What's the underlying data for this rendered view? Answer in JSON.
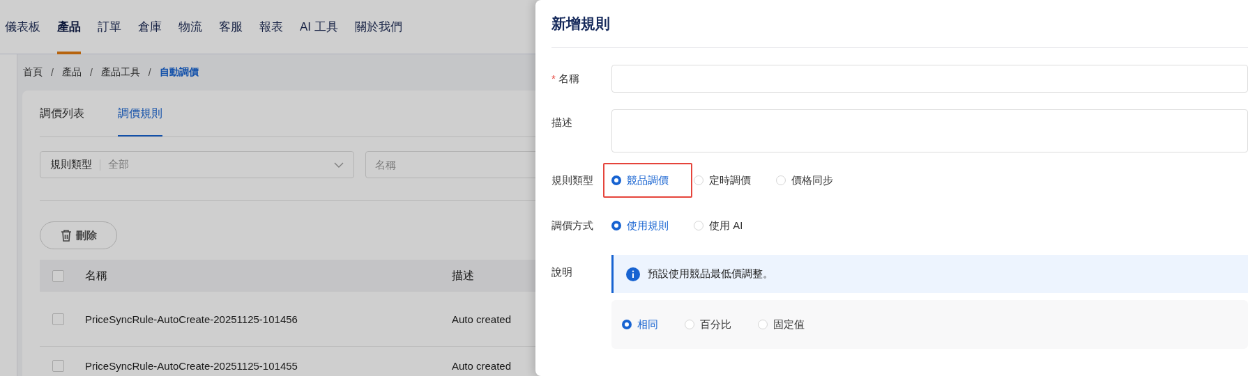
{
  "nav": [
    {
      "label": "儀表板",
      "selected": false
    },
    {
      "label": "產品",
      "selected": true
    },
    {
      "label": "訂單",
      "selected": false
    },
    {
      "label": "倉庫",
      "selected": false
    },
    {
      "label": "物流",
      "selected": false
    },
    {
      "label": "客服",
      "selected": false
    },
    {
      "label": "報表",
      "selected": false
    },
    {
      "label": "AI 工具",
      "selected": false
    },
    {
      "label": "關於我們",
      "selected": false
    }
  ],
  "breadcrumb": {
    "separator": "/",
    "items": [
      {
        "label": "首頁",
        "current": false
      },
      {
        "label": "產品",
        "current": false
      },
      {
        "label": "產品工具",
        "current": false
      },
      {
        "label": "自動調價",
        "current": true
      }
    ]
  },
  "tabs": [
    {
      "label": "調價列表",
      "selected": false
    },
    {
      "label": "調價規則",
      "selected": true
    }
  ],
  "filters": {
    "rule_type": {
      "label": "規則類型",
      "value": "全部"
    },
    "name": {
      "placeholder": "名稱"
    }
  },
  "delete_button": "刪除",
  "table": {
    "columns": [
      "名稱",
      "描述"
    ],
    "header_checked": false,
    "rows": [
      {
        "checked": false,
        "name": "PriceSyncRule-AutoCreate-20251125-101456",
        "description": "Auto created"
      },
      {
        "checked": false,
        "name": "PriceSyncRule-AutoCreate-20251125-101455",
        "description": "Auto created"
      }
    ]
  },
  "drawer": {
    "title": "新增規則",
    "required_mark": "*",
    "fields": [
      {
        "kind": "input",
        "label": "名稱",
        "required": true
      },
      {
        "kind": "textarea",
        "label": "描述",
        "required": false
      },
      {
        "kind": "radio",
        "label": "規則類型",
        "options": [
          {
            "label": "競品調價",
            "selected": true,
            "highlighted": true
          },
          {
            "label": "定時調價",
            "selected": false,
            "highlighted": false
          },
          {
            "label": "價格同步",
            "selected": false,
            "highlighted": false
          }
        ]
      },
      {
        "kind": "radio",
        "label": "調價方式",
        "options": [
          {
            "label": "使用規則",
            "selected": true,
            "highlighted": false
          },
          {
            "label": "使用 AI",
            "selected": false,
            "highlighted": false
          }
        ]
      },
      {
        "kind": "info",
        "label": "說明",
        "message": "預設使用競品最低價調整。",
        "options": [
          {
            "label": "相同",
            "selected": true
          },
          {
            "label": "百分比",
            "selected": false
          },
          {
            "label": "固定值",
            "selected": false
          }
        ]
      }
    ]
  }
}
